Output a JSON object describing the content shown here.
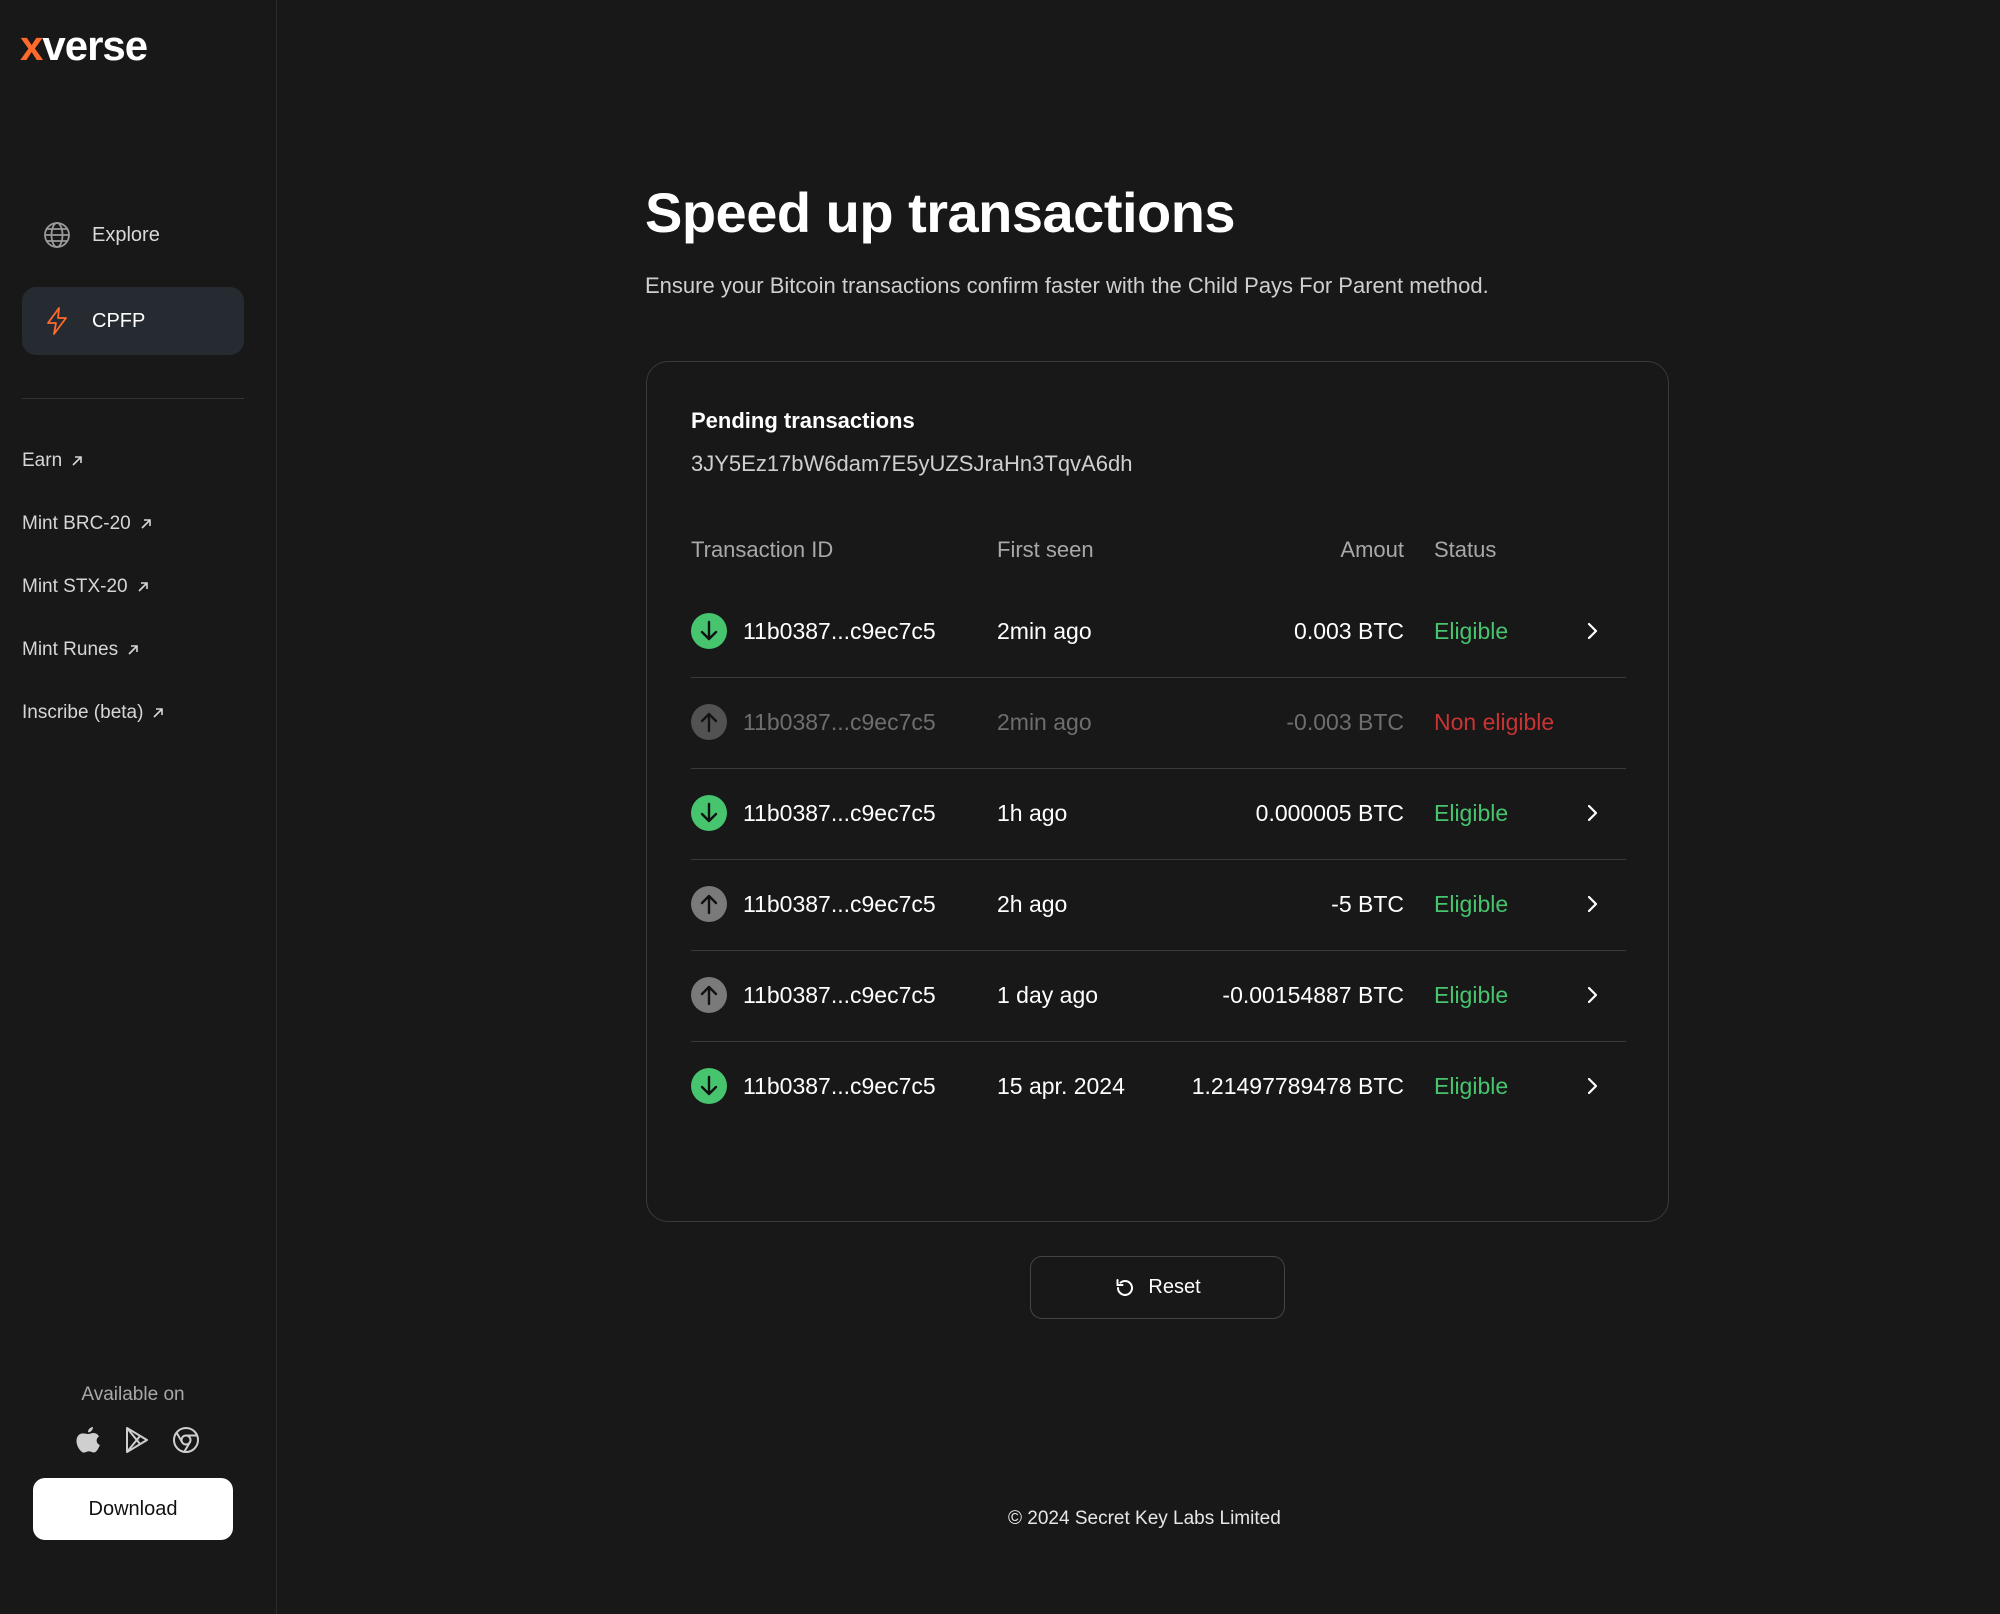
{
  "brand": {
    "logo_x": "x",
    "logo_rest": "verse"
  },
  "sidebar": {
    "nav": [
      {
        "label": "Explore",
        "icon": "globe-icon",
        "active": false
      },
      {
        "label": "CPFP",
        "icon": "lightning-icon",
        "active": true
      }
    ],
    "links": [
      {
        "label": "Earn"
      },
      {
        "label": "Mint BRC-20"
      },
      {
        "label": "Mint STX-20"
      },
      {
        "label": "Mint Runes"
      },
      {
        "label": "Inscribe (beta)"
      }
    ],
    "available_on": "Available on",
    "stores": [
      "apple-icon",
      "google-play-icon",
      "chrome-icon"
    ],
    "download_label": "Download"
  },
  "main": {
    "title": "Speed up transactions",
    "subtitle": "Ensure your Bitcoin transactions confirm faster with the Child Pays For Parent method.",
    "card": {
      "title": "Pending transactions",
      "address": "3JY5Ez17bW6dam7E5yUZSJraHn3TqvA6dh",
      "columns": {
        "txid": "Transaction ID",
        "first_seen": "First seen",
        "amount": "Amout",
        "status": "Status"
      },
      "rows": [
        {
          "direction": "incoming",
          "txid": "11b0387...c9ec7c5",
          "first_seen": "2min ago",
          "amount": "0.003 BTC",
          "status": "Eligible",
          "eligible": true
        },
        {
          "direction": "outgoing",
          "txid": "11b0387...c9ec7c5",
          "first_seen": "2min ago",
          "amount": "-0.003 BTC",
          "status": "Non eligible",
          "eligible": false
        },
        {
          "direction": "incoming",
          "txid": "11b0387...c9ec7c5",
          "first_seen": "1h ago",
          "amount": "0.000005 BTC",
          "status": "Eligible",
          "eligible": true
        },
        {
          "direction": "outgoing",
          "txid": "11b0387...c9ec7c5",
          "first_seen": "2h ago",
          "amount": "-5 BTC",
          "status": "Eligible",
          "eligible": true
        },
        {
          "direction": "outgoing",
          "txid": "11b0387...c9ec7c5",
          "first_seen": "1 day ago",
          "amount": "-0.00154887 BTC",
          "status": "Eligible",
          "eligible": true
        },
        {
          "direction": "incoming",
          "txid": "11b0387...c9ec7c5",
          "first_seen": "15 apr. 2024",
          "amount": "1.21497789478 BTC",
          "status": "Eligible",
          "eligible": true
        }
      ]
    },
    "reset_label": "Reset",
    "footer": "© 2024 Secret Key Labs Limited"
  },
  "colors": {
    "background": "#181818",
    "accent_orange": "#ff6a2c",
    "eligible_green": "#46c46e",
    "non_eligible_red": "#e03a3a",
    "incoming_icon": "#46c46e",
    "outgoing_icon": "#7a7a7a"
  }
}
